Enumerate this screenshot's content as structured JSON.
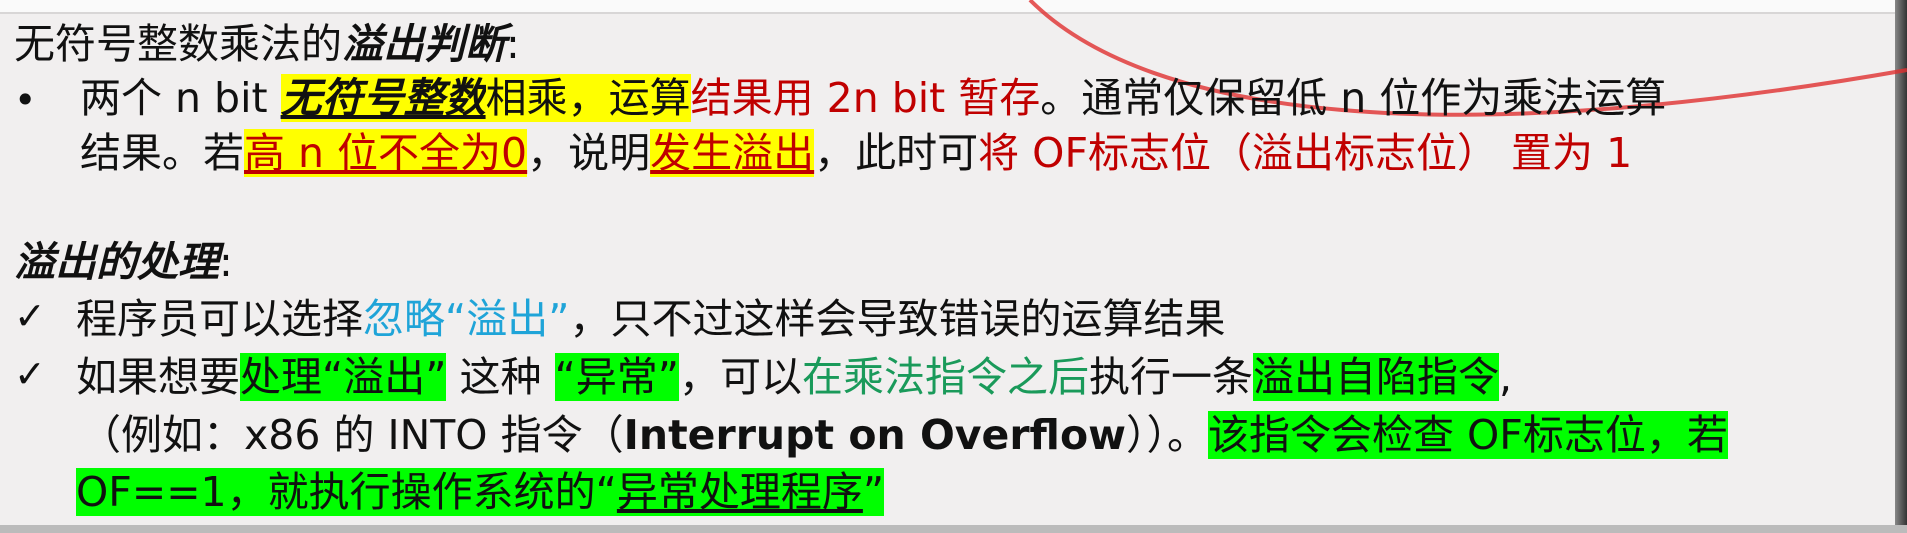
{
  "title1": {
    "a": "无符号整数乘法的",
    "b": "溢出判断",
    "c": ":"
  },
  "bullet1": {
    "mark": "•",
    "l1": [
      "两个 n bit ",
      "无符号整数",
      "相乘，运算",
      "结果用 2n bit 暂存",
      "。通常仅保留低 n 位作为乘法运算"
    ],
    "l2": [
      "结果。若",
      "高 n 位不全为0",
      "，说明",
      "发生溢出",
      "，此时可",
      "将 OF标志位（溢出标志位） 置为 1"
    ]
  },
  "title2": {
    "a": "溢出的处理",
    "c": ":"
  },
  "check1": {
    "mark": "✓",
    "parts": [
      "程序员可以选择",
      "忽略“溢出”",
      "，只不过这样会导致错误的运算结果"
    ]
  },
  "check2": {
    "mark": "✓",
    "l1": [
      "如果想要",
      "处理“溢出”",
      " 这种 ",
      "“异常”",
      "，可以",
      "在乘法指令之后",
      "执行一条",
      "溢出自陷指令",
      ","
    ],
    "l2": [
      "（例如：x86 的 INTO 指令（",
      "Interrupt on Overflow",
      "））。",
      "该指令会检查 OF标志位，若"
    ],
    "l3": [
      "OF==1，就执行操作系统的“",
      "异常处理程序",
      "”"
    ]
  },
  "colors": {
    "red": "#c00000",
    "yellow": "#ffff00",
    "green": "#00ff00",
    "blue": "#1fa4d8",
    "teal": "#1a9a5a",
    "annotation": "#e03030"
  }
}
